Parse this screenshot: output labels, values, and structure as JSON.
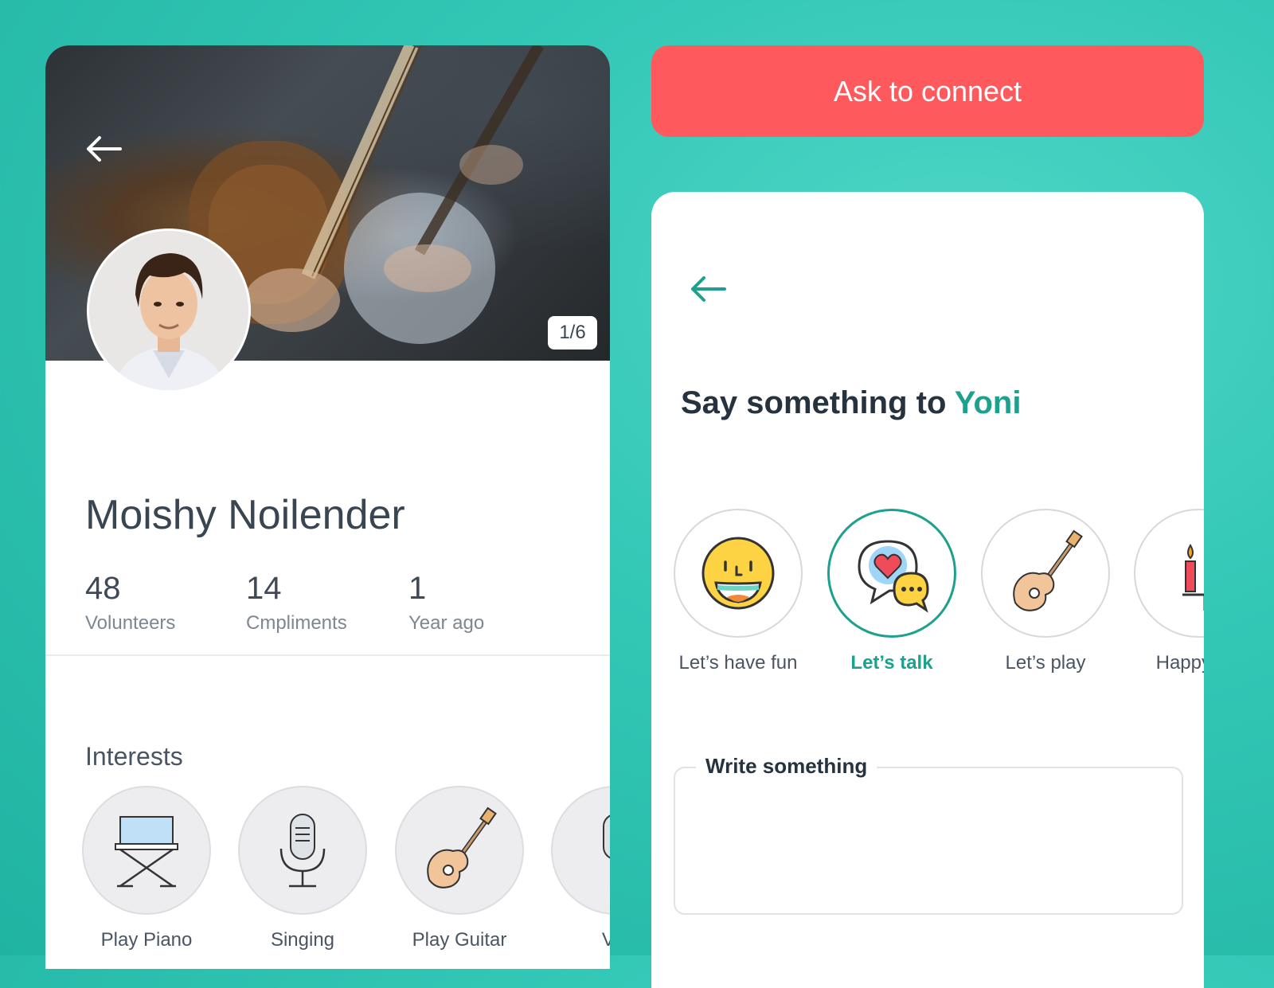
{
  "profile": {
    "photo_counter": "1/6",
    "name": "Moishy Noilender",
    "stats": [
      {
        "value": "48",
        "label": "Volunteers"
      },
      {
        "value": "14",
        "label": "Cmpliments"
      },
      {
        "value": "1",
        "label": "Year ago"
      }
    ],
    "interests_title": "Interests",
    "interests": [
      {
        "label": "Play Piano",
        "icon": "director-chair-icon"
      },
      {
        "label": "Singing",
        "icon": "microphone-icon"
      },
      {
        "label": "Play Guitar",
        "icon": "guitar-icon"
      },
      {
        "label": "Vid",
        "icon": "video-icon"
      }
    ]
  },
  "connect_button": {
    "label": "Ask to connect"
  },
  "message": {
    "heading_prefix": "Say something to",
    "heading_name": "Yoni",
    "options": [
      {
        "label": "Let’s have fun",
        "icon": "smiley-face-icon",
        "selected": false
      },
      {
        "label": "Let’s talk",
        "icon": "chat-bubbles-heart-icon",
        "selected": true
      },
      {
        "label": "Let’s play",
        "icon": "guitar-icon",
        "selected": false
      },
      {
        "label": "Happy Ha",
        "icon": "candles-icon",
        "selected": false
      }
    ],
    "write_label": "Write something",
    "write_value": ""
  },
  "colors": {
    "background": "#2cc0ae",
    "accent": "#1da08e",
    "connect_button": "#fe5a5e"
  }
}
